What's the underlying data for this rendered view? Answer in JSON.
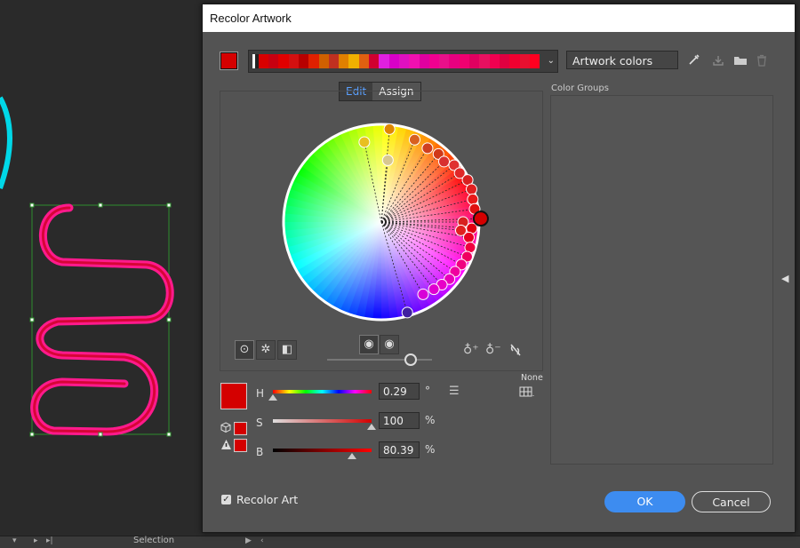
{
  "dialog": {
    "title": "Recolor Artwork",
    "artwork_field_value": "Artwork colors",
    "tabs": [
      {
        "label": "Edit",
        "active": true
      },
      {
        "label": "Assign",
        "active": false
      }
    ],
    "color_groups_label": "Color Groups",
    "sliders": {
      "h": {
        "label": "H",
        "value": "0.29",
        "unit": "°",
        "level": 0.0
      },
      "s": {
        "label": "S",
        "value": "100",
        "unit": "%",
        "level": 1.0
      },
      "b": {
        "label": "B",
        "value": "80.39",
        "unit": "%",
        "level": 0.8
      }
    },
    "none_label": "None",
    "recolor_art_label": "Recolor Art",
    "recolor_art_checked": true,
    "ok_label": "OK",
    "cancel_label": "Cancel",
    "current_color": "#d40000",
    "icons": [
      "eyedropper-icon",
      "save-group-icon",
      "folder-icon",
      "trash-icon",
      "add-color-icon",
      "remove-color-icon",
      "unlink-icon",
      "list-icon",
      "grid-icon"
    ]
  },
  "statusbar": {
    "tool_label": "Selection"
  }
}
